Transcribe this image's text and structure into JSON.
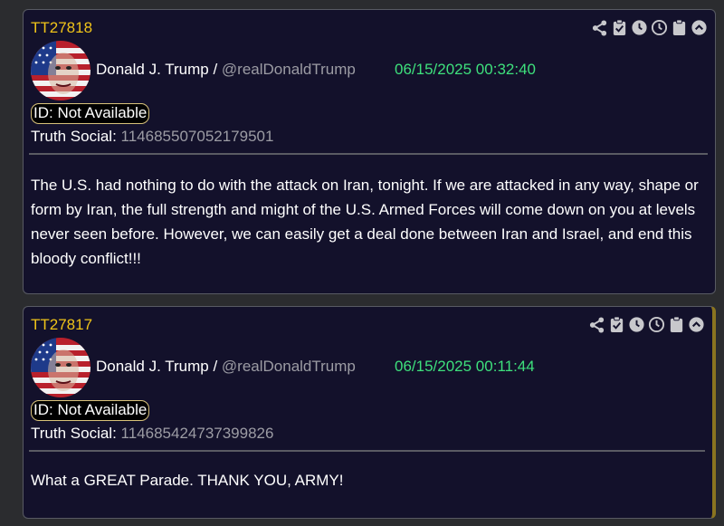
{
  "posts": [
    {
      "tt_id": "TT27818",
      "author_name": "Donald J. Trump",
      "separator": " / ",
      "handle": "@realDonaldTrump",
      "timestamp": "06/15/2025 00:32:40",
      "id_badge": "ID: Not Available",
      "source_label": "Truth Social:",
      "source_id": "114685507052179501",
      "text": "The U.S. had nothing to do with the attack on Iran, tonight. If we are attacked in any way, shape or form by Iran, the full strength and might of the U.S. Armed Forces will come down on you at levels never seen before. However, we can easily get a deal done between Iran and Israel, and end this bloody conflict!!!"
    },
    {
      "tt_id": "TT27817",
      "author_name": "Donald J. Trump",
      "separator": " / ",
      "handle": "@realDonaldTrump",
      "timestamp": "06/15/2025 00:11:44",
      "id_badge": "ID: Not Available",
      "source_label": "Truth Social:",
      "source_id": "114685424737399826",
      "text": "What a GREAT Parade. THANK YOU, ARMY!"
    }
  ],
  "toolbar_icons": [
    "share-icon",
    "clipboard-check-icon",
    "clock-filled-icon",
    "clock-outline-icon",
    "clipboard-icon",
    "chevron-up-circle-icon"
  ],
  "colors": {
    "tt_id": "#f0c419",
    "timestamp": "#3ee07c",
    "card_bg": "#13112b",
    "page_bg": "#2b2c2f",
    "handle": "#9c9ca4"
  }
}
